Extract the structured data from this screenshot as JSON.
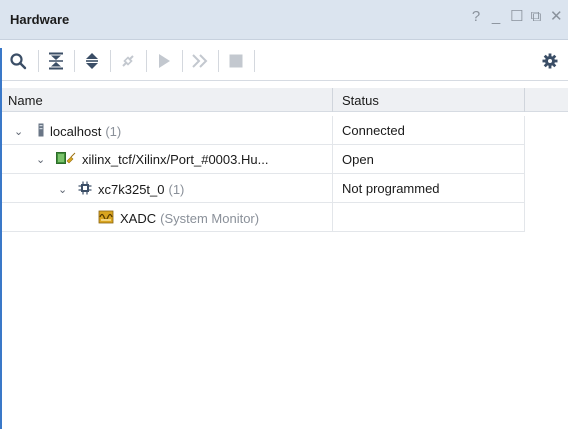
{
  "window": {
    "title": "Hardware",
    "controls": [
      "?",
      "_",
      "☐",
      "⧉",
      "✕"
    ]
  },
  "toolbar": {
    "icons": [
      "search-icon",
      "collapse-all-icon",
      "expand-all-icon",
      "auto-connect-icon",
      "run-icon",
      "run-all-icon",
      "stop-icon",
      "settings-icon"
    ]
  },
  "table": {
    "headers": {
      "name": "Name",
      "status": "Status"
    },
    "rows": [
      {
        "name": "localhost",
        "count": "(1)",
        "status": "Connected",
        "icon": "server-icon"
      },
      {
        "name": "xilinx_tcf/Xilinx/Port_#0003.Hu...",
        "count": "",
        "status": "Open",
        "icon": "jtag-cable-icon"
      },
      {
        "name": "xc7k325t_0",
        "count": "(1)",
        "status": "Not programmed",
        "icon": "fpga-chip-icon"
      },
      {
        "name": "XADC",
        "count": "(System Monitor)",
        "status": "",
        "icon": "xadc-icon"
      }
    ]
  },
  "colors": {
    "accent": "#3a78c8",
    "titlebar": "#dbe4ef",
    "toolbar_icon": "#3b4e66"
  }
}
